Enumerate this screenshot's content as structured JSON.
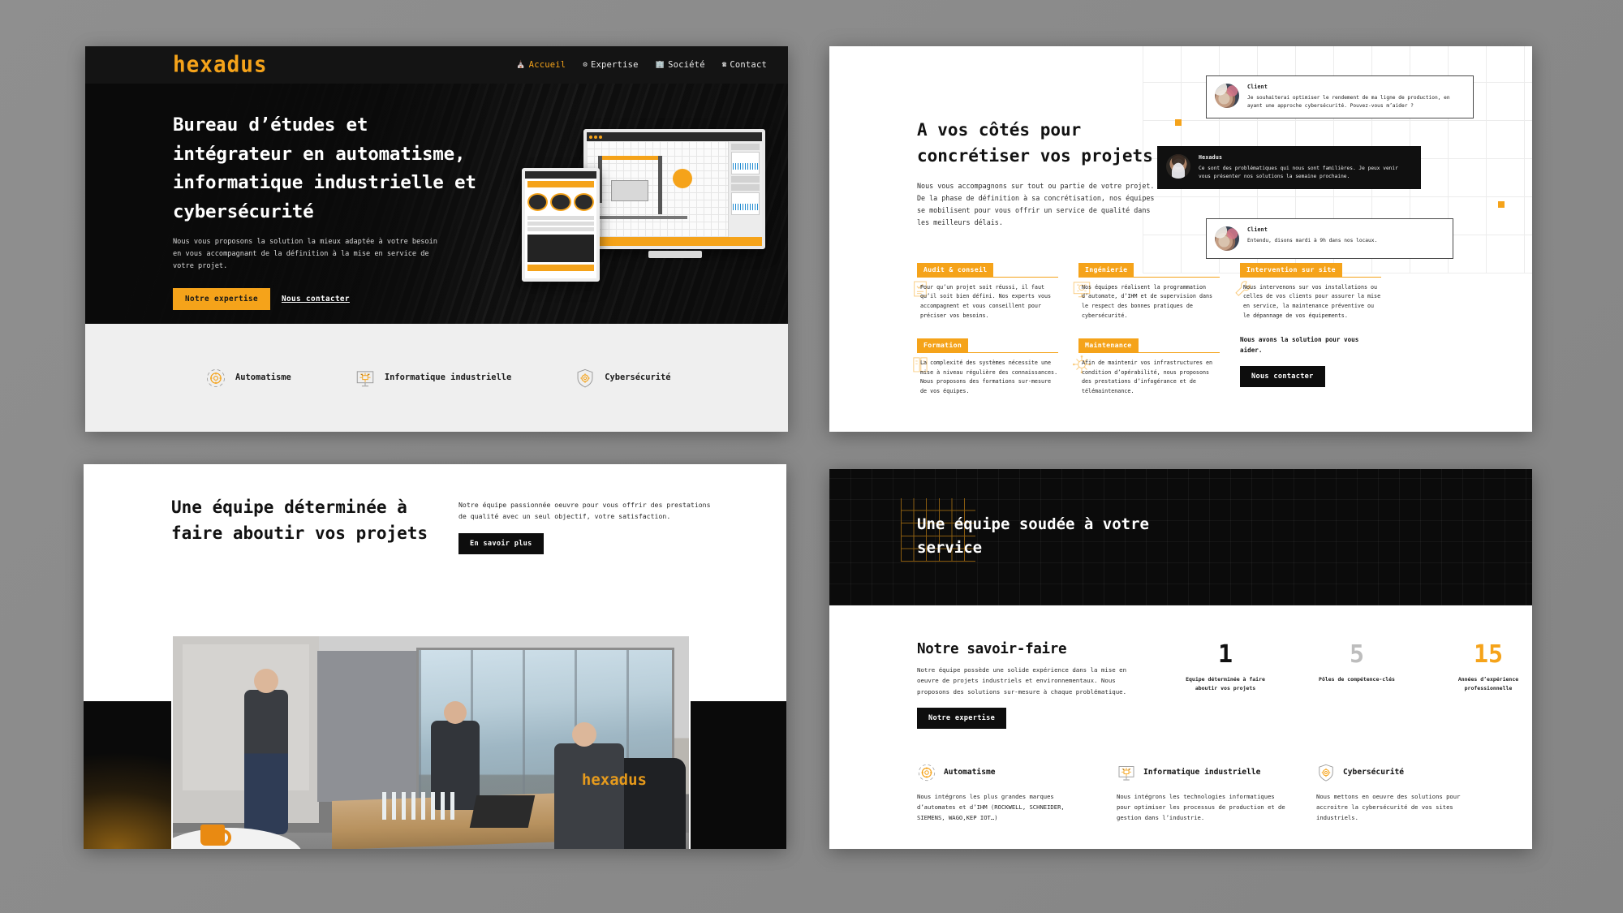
{
  "brand": {
    "name": "hexadus",
    "accent": "#F5A31A",
    "dark": "#101010"
  },
  "panel_home": {
    "nav": {
      "logo": "hexadus",
      "links": [
        {
          "label": "Accueil",
          "icon": "home-icon",
          "glyph": "⌂",
          "active": true
        },
        {
          "label": "Expertise",
          "icon": "gear-icon",
          "glyph": "⚙",
          "active": false
        },
        {
          "label": "Société",
          "icon": "building-icon",
          "glyph": "Ἶ2",
          "active": false
        },
        {
          "label": "Contact",
          "icon": "phone-icon",
          "glyph": "✆",
          "active": false
        }
      ]
    },
    "hero": {
      "title": "Bureau d’études et intégrateur en automatisme, informatique industrielle et cybersécurité",
      "subtitle": "Nous vous proposons la solution la mieux adaptée à votre besoin en vous accompagnant de la définition à la mise en service de votre projet.",
      "primary_cta": "Notre expertise",
      "secondary_cta": "Nous contacter"
    },
    "features": [
      {
        "label": "Automatisme",
        "icon": "gear-orbit-icon"
      },
      {
        "label": "Informatique industrielle",
        "icon": "monitor-chip-icon"
      },
      {
        "label": "Cybersécurité",
        "icon": "shield-gear-icon"
      }
    ]
  },
  "panel_approach": {
    "title": "A vos côtés pour concrétiser vos projets",
    "description": "Nous vous accompagnons sur tout ou partie de votre projet. De la phase de définition à sa concrétisation, nos équipes se mobilisent pour vous offrir un service de qualité dans les meilleurs délais.",
    "conversation": [
      {
        "author": "Client",
        "message": "Je souhaiterai optimiser le rendement de ma ligne de production, en ayant une approche cybersécurité. Pouvez-vous m’aider ?",
        "theme": "light",
        "avatar": "client-avatar"
      },
      {
        "author": "Hexadus",
        "message": "Ce sont des problématiques qui nous sont familières. Je peux venir vous présenter nos solutions la semaine prochaine.",
        "theme": "dark",
        "avatar": "hexadus-avatar"
      },
      {
        "author": "Client",
        "message": "Entendu, disons mardi à 9h dans nos locaux.",
        "theme": "light",
        "avatar": "client-avatar"
      }
    ],
    "cards": [
      {
        "tag": "Audit & conseil",
        "text": "Pour qu’un projet soit réussi, il faut qu’il soit bien défini. Nos experts vous accompagnent et vous conseillent pour préciser vos besoins.",
        "icon": "checklist-icon"
      },
      {
        "tag": "Ingénierie",
        "text": "Nos équipes réalisent la programmation d’automate, d’IHM et de supervision dans le respect des bonnes pratiques de cybersécurité.",
        "icon": "monitor-chip-icon"
      },
      {
        "tag": "Intervention sur site",
        "text": "Nous intervenons sur vos installations ou celles de vos clients pour assurer la mise en service, la maintenance préventive ou le dépannage de vos équipements.",
        "icon": "wrench-icon"
      },
      {
        "tag": "Formation",
        "text": "La complexité des systèmes nécessite une mise à niveau régulière des connaissances. Nous proposons des formations sur-mesure de vos équipes.",
        "icon": "book-icon"
      },
      {
        "tag": "Maintenance",
        "text": "Afin de maintenir vos infrastructures en condition d’opérabilité, nous proposons des prestations d’infogérance et de télémaintenance.",
        "icon": "gear-network-icon"
      }
    ],
    "cta": {
      "text": "Nous avons la solution pour vous aider.",
      "button": "Nous contacter"
    }
  },
  "panel_team": {
    "title": "Une équipe déterminée à faire aboutir vos projets",
    "description": "Notre équipe passionnée oeuvre pour vous offrir des prestations de qualité  avec un seul objectif, votre satisfaction.",
    "cta": "En savoir plus",
    "photo_caption": "hexadus"
  },
  "panel_know": {
    "hero_title": "Une équipe soudée à votre service",
    "heading": "Notre savoir-faire",
    "description": "Notre équipe possède une solide expérience dans la mise en oeuvre de projets industriels et environnementaux. Nous proposons des solutions sur-mesure à chaque problématique.",
    "cta": "Notre expertise",
    "stats": [
      {
        "value": "1",
        "label": "Equipe déterminée à faire aboutir vos projets",
        "color": "#101010"
      },
      {
        "value": "5",
        "label": "Pôles de compétence-clés",
        "color": "#BDBDBD"
      },
      {
        "value": "15",
        "label": "Années d’expérience professionnelle",
        "color": "#F5A31A"
      }
    ],
    "features": [
      {
        "title": "Automatisme",
        "icon": "gear-orbit-icon",
        "text": "Nous intégrons les plus grandes marques d’automates et d’IHM (ROCKWELL, SCHNEIDER, SIEMENS, WAGO,KEP IOT…)"
      },
      {
        "title": "Informatique industrielle",
        "icon": "monitor-chip-icon",
        "text": "Nous intégrons les technologies informatiques pour optimiser les processus de production et de gestion dans l’industrie."
      },
      {
        "title": "Cybersécurité",
        "icon": "shield-gear-icon",
        "text": "Nous mettons en oeuvre des solutions pour accroitre la cybersécurité de vos sites industriels."
      }
    ]
  }
}
